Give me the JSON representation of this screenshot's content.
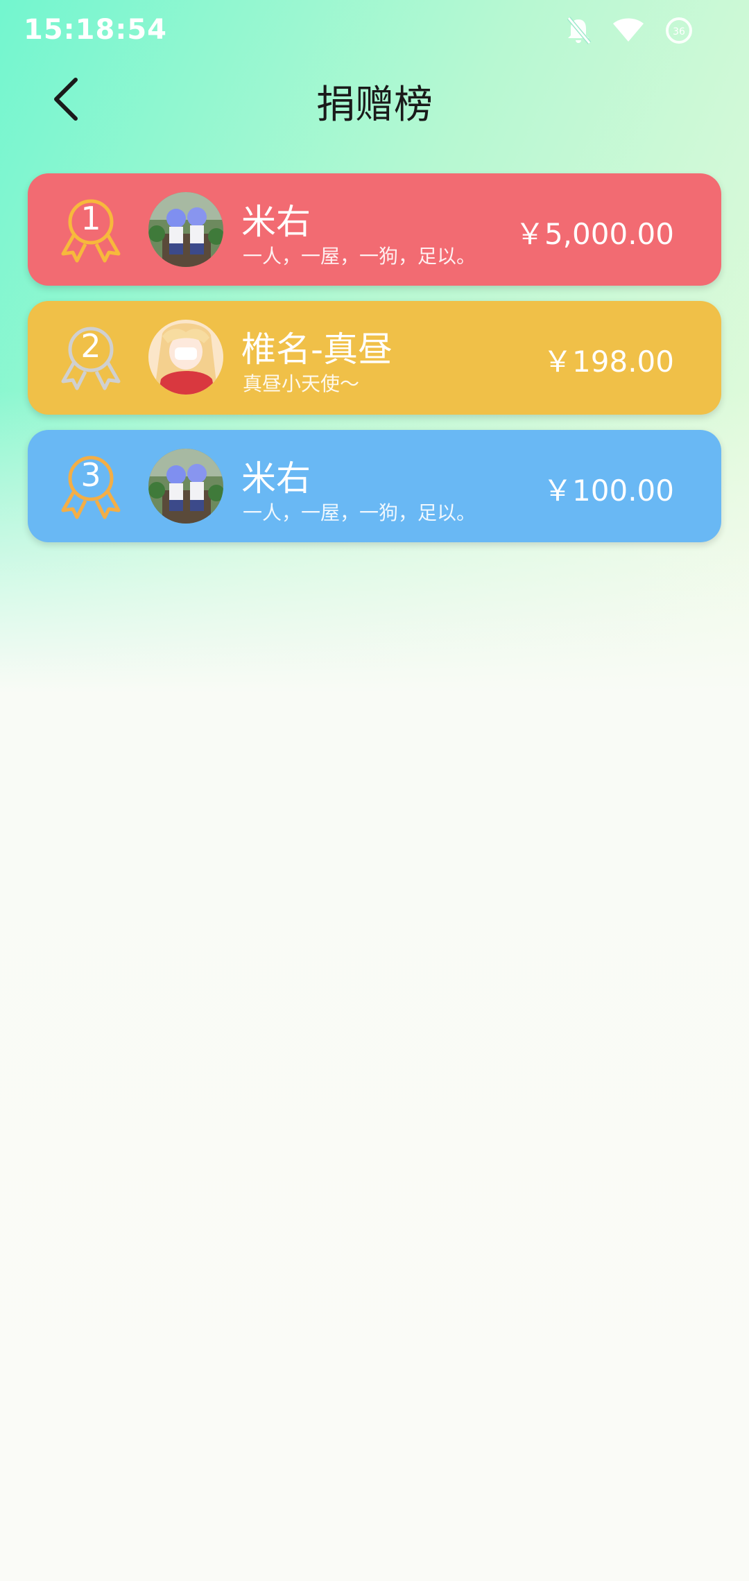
{
  "status_bar": {
    "time": "15:18:54",
    "icons": [
      "notifications-off-icon",
      "wifi-icon",
      "battery-icon"
    ]
  },
  "header": {
    "back_icon": "chevron-left-icon",
    "title": "捐赠榜"
  },
  "ranking": [
    {
      "rank": "1",
      "name": "米右",
      "motto": "一人，一屋，一狗，足以。",
      "amount": "￥5,000.00",
      "card_color": "#f26b72",
      "medal_color": "#f7b93c"
    },
    {
      "rank": "2",
      "name": "椎名-真昼",
      "motto": "真昼小天使～",
      "amount": "￥198.00",
      "card_color": "#f0c048",
      "medal_color": "#d0d0d0"
    },
    {
      "rank": "3",
      "name": "米右",
      "motto": "一人，一屋，一狗，足以。",
      "amount": "￥100.00",
      "card_color": "#69b8f4",
      "medal_color": "#f3ae46"
    }
  ]
}
